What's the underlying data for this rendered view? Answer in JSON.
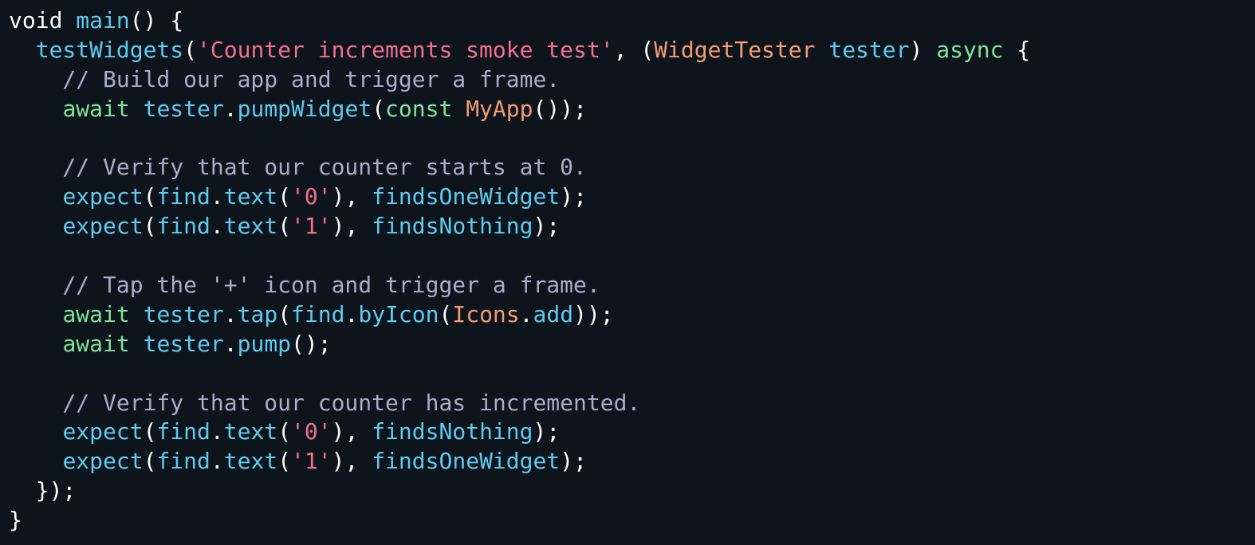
{
  "colors": {
    "background": "#0e141c",
    "plain": "#ffffff",
    "function": "#5ecbf0",
    "keyword": "#7ee49a",
    "string": "#f2708f",
    "type": "#f29c72",
    "comment": "#a8adc9"
  },
  "code": {
    "lines": [
      [
        {
          "t": "void ",
          "k": "plain"
        },
        {
          "t": "main",
          "k": "fn"
        },
        {
          "t": "() {",
          "k": "plain"
        }
      ],
      [
        {
          "t": "  ",
          "k": "plain"
        },
        {
          "t": "testWidgets",
          "k": "fn"
        },
        {
          "t": "(",
          "k": "plain"
        },
        {
          "t": "'Counter increments smoke test'",
          "k": "str"
        },
        {
          "t": ", (",
          "k": "plain"
        },
        {
          "t": "WidgetTester",
          "k": "typ"
        },
        {
          "t": " ",
          "k": "plain"
        },
        {
          "t": "tester",
          "k": "fn"
        },
        {
          "t": ") ",
          "k": "plain"
        },
        {
          "t": "async",
          "k": "kw"
        },
        {
          "t": " {",
          "k": "plain"
        }
      ],
      [
        {
          "t": "    // Build our app and trigger a frame.",
          "k": "cmt"
        }
      ],
      [
        {
          "t": "    ",
          "k": "plain"
        },
        {
          "t": "await",
          "k": "kw"
        },
        {
          "t": " ",
          "k": "plain"
        },
        {
          "t": "tester",
          "k": "fn"
        },
        {
          "t": ".",
          "k": "plain"
        },
        {
          "t": "pumpWidget",
          "k": "fn"
        },
        {
          "t": "(",
          "k": "plain"
        },
        {
          "t": "const",
          "k": "kw"
        },
        {
          "t": " ",
          "k": "plain"
        },
        {
          "t": "MyApp",
          "k": "typ"
        },
        {
          "t": "());",
          "k": "plain"
        }
      ],
      [],
      [
        {
          "t": "    // Verify that our counter starts at 0.",
          "k": "cmt"
        }
      ],
      [
        {
          "t": "    ",
          "k": "plain"
        },
        {
          "t": "expect",
          "k": "fn"
        },
        {
          "t": "(",
          "k": "plain"
        },
        {
          "t": "find",
          "k": "fn"
        },
        {
          "t": ".",
          "k": "plain"
        },
        {
          "t": "text",
          "k": "fn"
        },
        {
          "t": "(",
          "k": "plain"
        },
        {
          "t": "'0'",
          "k": "str"
        },
        {
          "t": "), ",
          "k": "plain"
        },
        {
          "t": "findsOneWidget",
          "k": "fn"
        },
        {
          "t": ");",
          "k": "plain"
        }
      ],
      [
        {
          "t": "    ",
          "k": "plain"
        },
        {
          "t": "expect",
          "k": "fn"
        },
        {
          "t": "(",
          "k": "plain"
        },
        {
          "t": "find",
          "k": "fn"
        },
        {
          "t": ".",
          "k": "plain"
        },
        {
          "t": "text",
          "k": "fn"
        },
        {
          "t": "(",
          "k": "plain"
        },
        {
          "t": "'1'",
          "k": "str"
        },
        {
          "t": "), ",
          "k": "plain"
        },
        {
          "t": "findsNothing",
          "k": "fn"
        },
        {
          "t": ");",
          "k": "plain"
        }
      ],
      [],
      [
        {
          "t": "    // Tap the '+' icon and trigger a frame.",
          "k": "cmt"
        }
      ],
      [
        {
          "t": "    ",
          "k": "plain"
        },
        {
          "t": "await",
          "k": "kw"
        },
        {
          "t": " ",
          "k": "plain"
        },
        {
          "t": "tester",
          "k": "fn"
        },
        {
          "t": ".",
          "k": "plain"
        },
        {
          "t": "tap",
          "k": "fn"
        },
        {
          "t": "(",
          "k": "plain"
        },
        {
          "t": "find",
          "k": "fn"
        },
        {
          "t": ".",
          "k": "plain"
        },
        {
          "t": "byIcon",
          "k": "fn"
        },
        {
          "t": "(",
          "k": "plain"
        },
        {
          "t": "Icons",
          "k": "typ"
        },
        {
          "t": ".",
          "k": "plain"
        },
        {
          "t": "add",
          "k": "fn"
        },
        {
          "t": "));",
          "k": "plain"
        }
      ],
      [
        {
          "t": "    ",
          "k": "plain"
        },
        {
          "t": "await",
          "k": "kw"
        },
        {
          "t": " ",
          "k": "plain"
        },
        {
          "t": "tester",
          "k": "fn"
        },
        {
          "t": ".",
          "k": "plain"
        },
        {
          "t": "pump",
          "k": "fn"
        },
        {
          "t": "();",
          "k": "plain"
        }
      ],
      [],
      [
        {
          "t": "    // Verify that our counter has incremented.",
          "k": "cmt"
        }
      ],
      [
        {
          "t": "    ",
          "k": "plain"
        },
        {
          "t": "expect",
          "k": "fn"
        },
        {
          "t": "(",
          "k": "plain"
        },
        {
          "t": "find",
          "k": "fn"
        },
        {
          "t": ".",
          "k": "plain"
        },
        {
          "t": "text",
          "k": "fn"
        },
        {
          "t": "(",
          "k": "plain"
        },
        {
          "t": "'0'",
          "k": "str"
        },
        {
          "t": "), ",
          "k": "plain"
        },
        {
          "t": "findsNothing",
          "k": "fn"
        },
        {
          "t": ");",
          "k": "plain"
        }
      ],
      [
        {
          "t": "    ",
          "k": "plain"
        },
        {
          "t": "expect",
          "k": "fn"
        },
        {
          "t": "(",
          "k": "plain"
        },
        {
          "t": "find",
          "k": "fn"
        },
        {
          "t": ".",
          "k": "plain"
        },
        {
          "t": "text",
          "k": "fn"
        },
        {
          "t": "(",
          "k": "plain"
        },
        {
          "t": "'1'",
          "k": "str"
        },
        {
          "t": "), ",
          "k": "plain"
        },
        {
          "t": "findsOneWidget",
          "k": "fn"
        },
        {
          "t": ");",
          "k": "plain"
        }
      ],
      [
        {
          "t": "  });",
          "k": "plain"
        }
      ],
      [
        {
          "t": "}",
          "k": "plain"
        }
      ]
    ]
  }
}
